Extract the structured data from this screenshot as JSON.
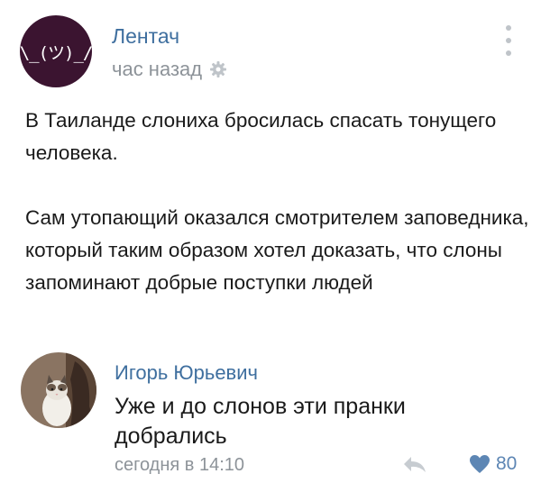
{
  "post": {
    "author": "Лентач",
    "avatar_logo": "\\_(ツ)_/",
    "time": "час назад",
    "paragraphs": [
      "В Таиланде слониха бросилась спасать тонущего человека.",
      "Сам утопающий оказался смотрителем заповедника, который таким образом хотел доказать, что слоны запоминают добрые поступки людей"
    ]
  },
  "comment": {
    "author": "Игорь Юрьевич",
    "text": "Уже и до слонов эти пранки добрались",
    "time": "сегодня в 14:10",
    "likes": "80"
  },
  "icons": {
    "settings": "gear-icon",
    "more": "more-vertical-icon",
    "reply": "reply-icon",
    "like": "heart-icon"
  },
  "colors": {
    "link": "#3f6f9f",
    "muted": "#8d9399",
    "avatar_bg": "#3b1430",
    "like": "#5d86b4"
  }
}
